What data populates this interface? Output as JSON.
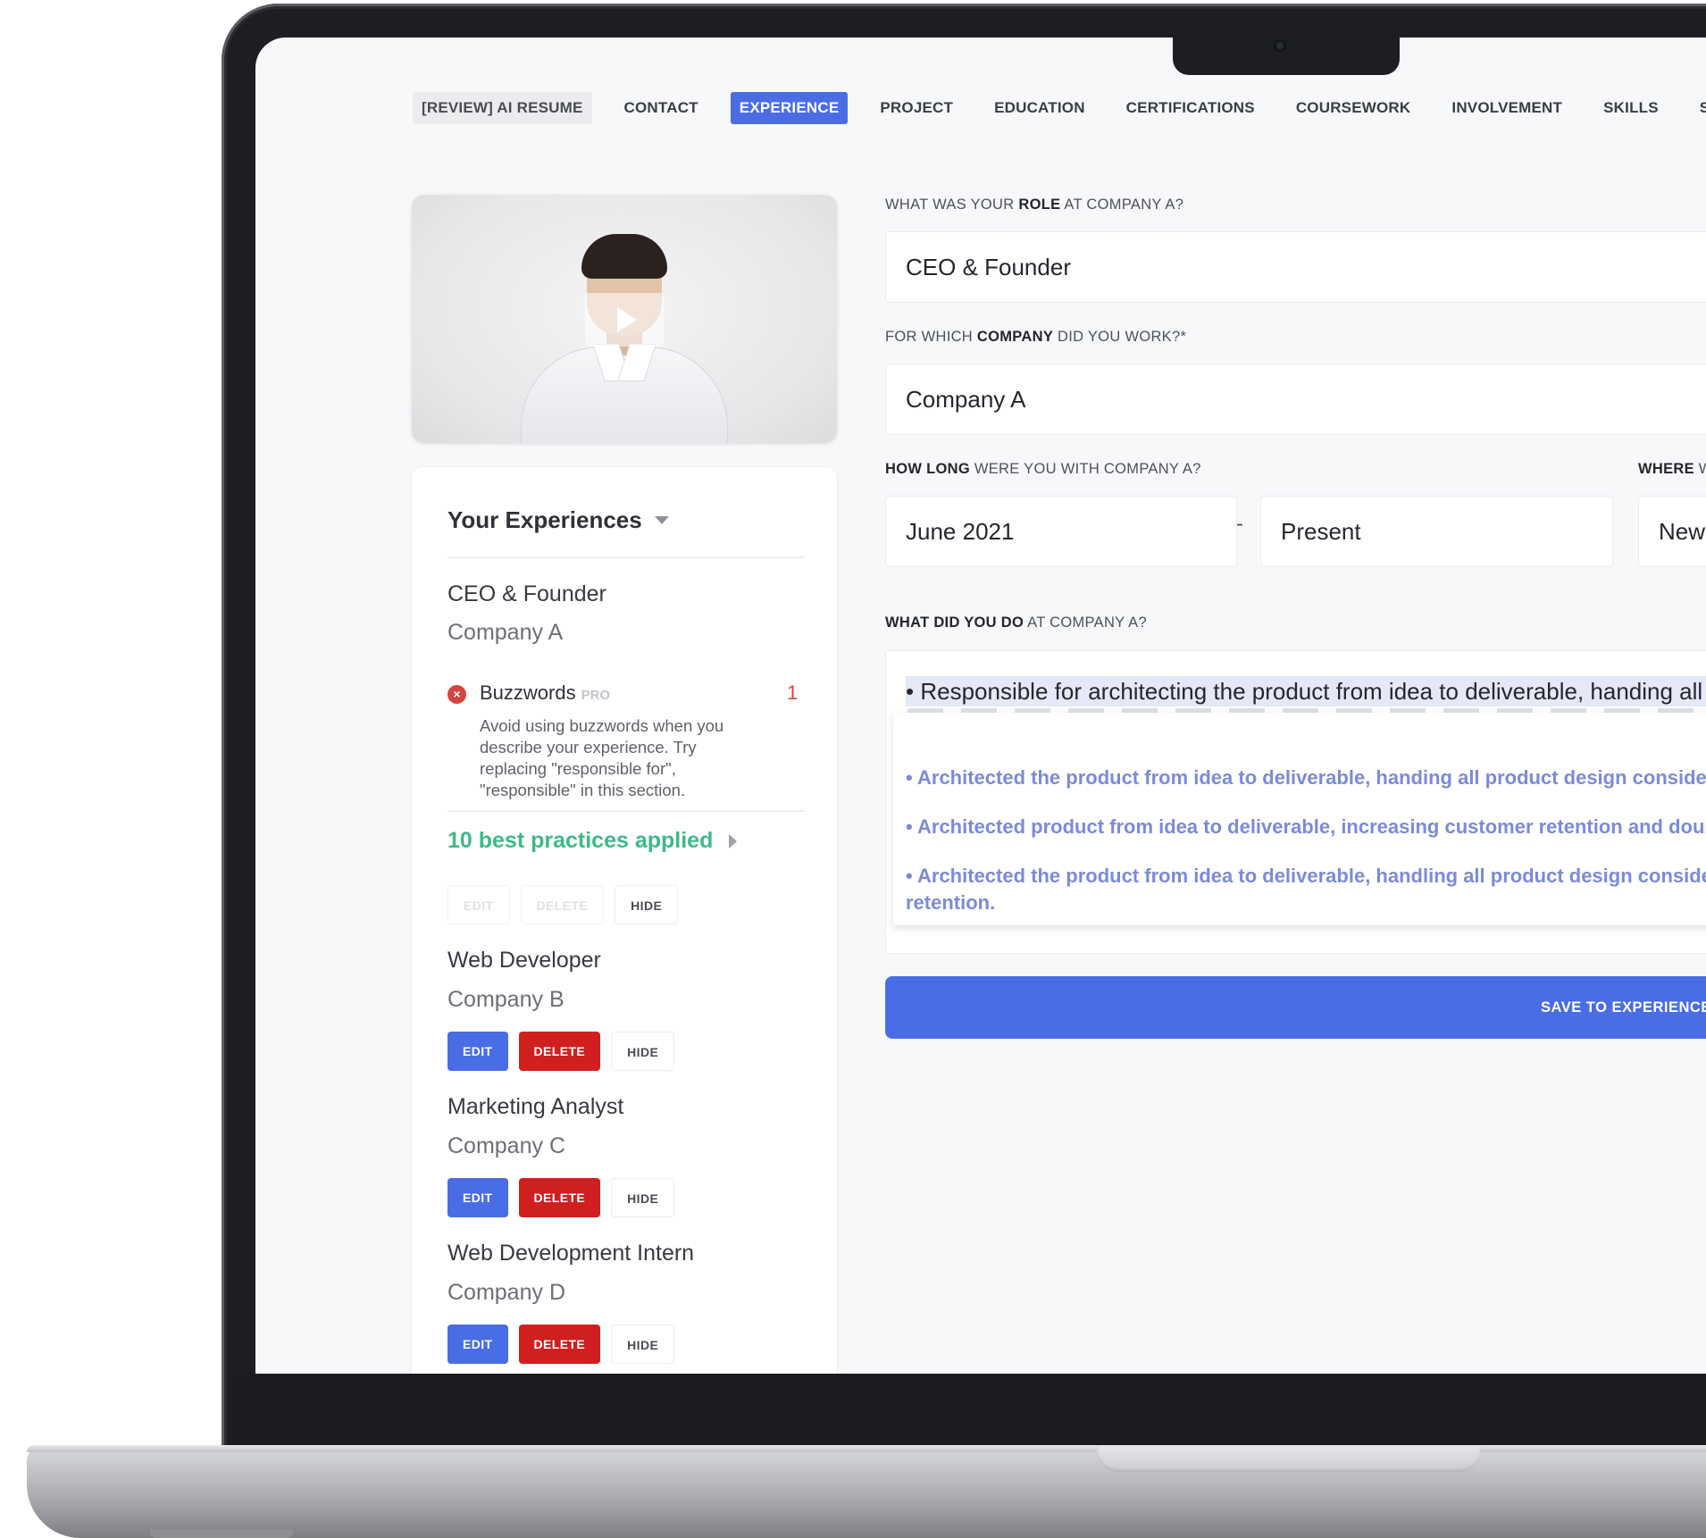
{
  "nav": {
    "items": [
      {
        "label": "[REVIEW] AI RESUME",
        "state": "review"
      },
      {
        "label": "CONTACT",
        "state": ""
      },
      {
        "label": "EXPERIENCE",
        "state": "active"
      },
      {
        "label": "PROJECT",
        "state": ""
      },
      {
        "label": "EDUCATION",
        "state": ""
      },
      {
        "label": "CERTIFICATIONS",
        "state": ""
      },
      {
        "label": "COURSEWORK",
        "state": ""
      },
      {
        "label": "INVOLVEMENT",
        "state": ""
      },
      {
        "label": "SKILLS",
        "state": ""
      },
      {
        "label": "SUMMARY",
        "state": ""
      }
    ]
  },
  "experiences": {
    "header": "Your Experiences",
    "items": [
      {
        "title": "CEO & Founder",
        "company": "Company A"
      },
      {
        "title": "Web Developer",
        "company": "Company B"
      },
      {
        "title": "Marketing Analyst",
        "company": "Company C"
      },
      {
        "title": "Web Development Intern",
        "company": "Company D"
      }
    ],
    "buzzwords": {
      "title": "Buzzwords",
      "badge": "PRO",
      "count": "1",
      "description": "Avoid using buzzwords when you describe your experience. Try replacing \"responsible for\", \"responsible\" in this section."
    },
    "best_practices": "10 best practices applied",
    "buttons": {
      "edit": "EDIT",
      "delete": "DELETE",
      "hide": "HIDE"
    }
  },
  "form": {
    "role_label": {
      "pre": "WHAT WAS YOUR ",
      "bold": "ROLE",
      "post": " AT COMPANY A?"
    },
    "role_value": "CEO & Founder",
    "company_label": {
      "pre": "FOR WHICH ",
      "bold": "COMPANY",
      "post": " DID YOU WORK?*"
    },
    "company_value": "Company A",
    "duration_label": {
      "bold": "HOW LONG",
      "post": " WERE YOU WITH COMPANY A?"
    },
    "start_value": "June 2021",
    "separator": "-",
    "end_value": "Present",
    "where_label": {
      "bold": "WHERE",
      "post": " W"
    },
    "where_value": "New",
    "desc_label": {
      "bold": "WHAT DID YOU DO",
      "post": " AT COMPANY A?"
    },
    "desc_value": "• Responsible for architecting the product from idea to deliverable, handing all p",
    "suggestions": [
      "• Architected the product from idea to deliverable, handing all product design considerat",
      "• Architected product from idea to deliverable, increasing customer retention and double",
      "• Architected the product from idea to deliverable, handling all product design considera"
    ],
    "suggestion_wrap": "retention.",
    "save_label": "SAVE TO EXPERIENCE I"
  },
  "colors": {
    "accent": "#4a6de5",
    "danger": "#d01f1f",
    "success": "#3fb98a",
    "suggestion": "#7b8bd6"
  }
}
